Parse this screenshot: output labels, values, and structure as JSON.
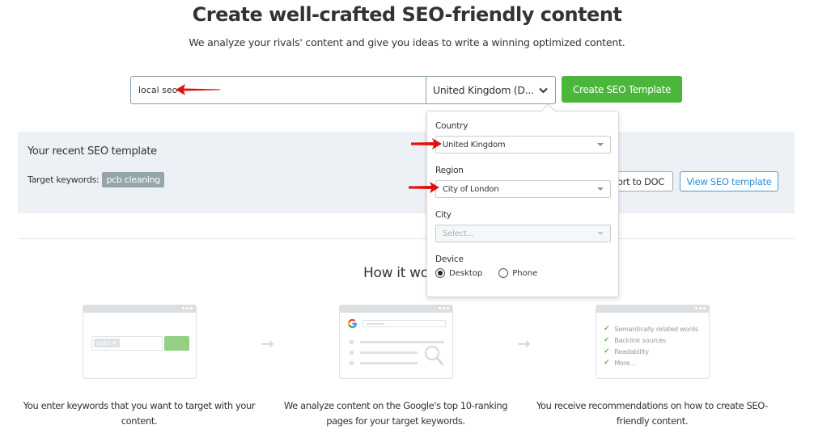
{
  "hero": {
    "title": "Create well-crafted SEO-friendly content",
    "subtitle": "We analyze your rivals' content and give you ideas to write a winning optimized content."
  },
  "search": {
    "keyword_value": "local seo",
    "database_label": "United Kingdom (D...",
    "create_button": "Create SEO Template"
  },
  "recent": {
    "title": "Your recent SEO template",
    "keywords_label": "Target keywords:",
    "keyword_tag": "pcb cleaning",
    "export_button": "Export to DOC",
    "export_visible": "ort to DOC",
    "view_button": "View SEO template"
  },
  "dropdown": {
    "country_label": "Country",
    "country_value": "United Kingdom",
    "region_label": "Region",
    "region_value": "City of London",
    "city_label": "City",
    "city_placeholder": "Select...",
    "device_label": "Device",
    "devices": [
      {
        "label": "Desktop",
        "checked": true
      },
      {
        "label": "Phone",
        "checked": false
      }
    ]
  },
  "how": {
    "title": "How it works",
    "title_visible": "How it wo",
    "steps": [
      {
        "description": "You enter keywords that you want to target with your content.",
        "illustration_tag": "cats ✕"
      },
      {
        "description": "We analyze content on the Google's top 10-ranking pages for your target keywords.",
        "illustration_logo": "G"
      },
      {
        "description": "You receive recommendations on how to create SEO-friendly content.",
        "checklist": [
          "Semantically related words",
          "Backlink sources",
          "Readability",
          "More..."
        ]
      }
    ]
  },
  "colors": {
    "primary_green": "#4ab63a",
    "link_blue": "#2e8ed6",
    "panel_bg": "#edf1f5",
    "tag_gray": "#95a5ac",
    "annotation_red": "#e01010"
  }
}
